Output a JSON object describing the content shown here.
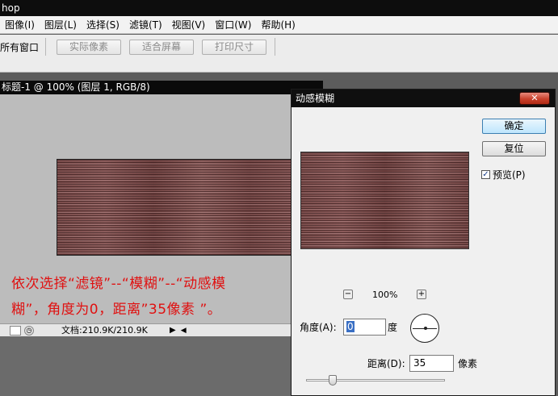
{
  "app": {
    "title": "hop"
  },
  "menu": [
    "图像(I)",
    "图层(L)",
    "选择(S)",
    "滤镜(T)",
    "视图(V)",
    "窗口(W)",
    "帮助(H)"
  ],
  "options": {
    "all_windows": "所有窗口",
    "actual_pixels": "实际像素",
    "fit_screen": "适合屏幕",
    "print_size": "打印尺寸"
  },
  "document": {
    "title": "标题-1 @ 100% (图层 1, RGB/8)",
    "instruction_line1": "依次选择“滤镜”--“模糊”--“动感模",
    "instruction_line2": "糊”，角度为0，距离”35像素 ”。",
    "status_info": "文档:210.9K/210.9K"
  },
  "dialog": {
    "title": "动感模糊",
    "close_label": "✕",
    "ok_label": "确定",
    "reset_label": "复位",
    "preview_label": "预览(P)",
    "preview_checked": true,
    "zoom_minus": "−",
    "zoom_plus": "+",
    "zoom_value": "100%",
    "angle_label": "角度(A):",
    "angle_value": "0",
    "angle_unit": "度",
    "distance_label": "距离(D):",
    "distance_value": "35",
    "distance_unit": "像素"
  },
  "colors": {
    "instruction_text": "#e01010",
    "texture_base": "#7a4c4b",
    "close_button": "#c9412c",
    "selection": "#3a6fc4"
  }
}
